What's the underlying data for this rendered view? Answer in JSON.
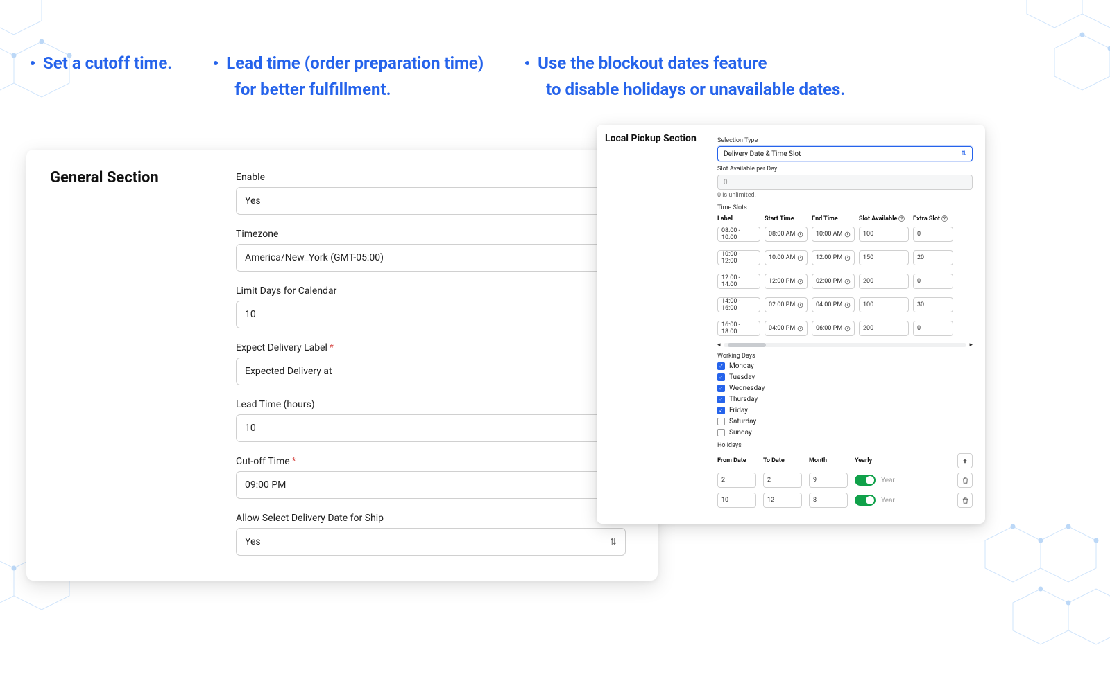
{
  "headlines": {
    "a": "Set a cutoff time.",
    "b1": "Lead time (order preparation time)",
    "b2": "for better fulfillment.",
    "c1": "Use the blockout dates feature",
    "c2": "to disable holidays or unavailable dates."
  },
  "general": {
    "title": "General Section",
    "enable": {
      "label": "Enable",
      "value": "Yes"
    },
    "timezone": {
      "label": "Timezone",
      "value": "America/New_York (GMT-05:00)"
    },
    "limit_days": {
      "label": "Limit Days for Calendar",
      "value": "10"
    },
    "expect_label": {
      "label": "Expect Delivery Label",
      "required": true,
      "value": "Expected Delivery at"
    },
    "lead_time": {
      "label": "Lead Time (hours)",
      "value": "10"
    },
    "cutoff": {
      "label": "Cut-off Time",
      "required": true,
      "value": "09:00 PM"
    },
    "allow_select": {
      "label": "Allow Select Delivery Date for Ship",
      "value": "Yes"
    }
  },
  "pickup": {
    "title": "Local Pickup Section",
    "selection_type": {
      "label": "Selection Type",
      "value": "Delivery Date & Time Slot"
    },
    "slot_avail_day": {
      "label": "Slot Available per Day",
      "value": "0",
      "help": "0 is unlimited."
    },
    "timeslots": {
      "label": "Time Slots",
      "headers": {
        "label": "Label",
        "start": "Start Time",
        "end": "End Time",
        "avail": "Slot Available",
        "extra": "Extra Slot"
      },
      "rows": [
        {
          "label": "08:00 - 10:00",
          "start": "08:00 AM",
          "end": "10:00 AM",
          "avail": "100",
          "extra": "0"
        },
        {
          "label": "10:00 - 12:00",
          "start": "10:00 AM",
          "end": "12:00 PM",
          "avail": "150",
          "extra": "20"
        },
        {
          "label": "12:00 - 14:00",
          "start": "12:00 PM",
          "end": "02:00 PM",
          "avail": "200",
          "extra": "0"
        },
        {
          "label": "14:00 - 16:00",
          "start": "02:00 PM",
          "end": "04:00 PM",
          "avail": "100",
          "extra": "30"
        },
        {
          "label": "16:00 - 18:00",
          "start": "04:00 PM",
          "end": "06:00 PM",
          "avail": "200",
          "extra": "0"
        }
      ]
    },
    "working_days": {
      "label": "Working Days",
      "days": [
        {
          "name": "Monday",
          "checked": true
        },
        {
          "name": "Tuesday",
          "checked": true
        },
        {
          "name": "Wednesday",
          "checked": true
        },
        {
          "name": "Thursday",
          "checked": true
        },
        {
          "name": "Friday",
          "checked": true
        },
        {
          "name": "Saturday",
          "checked": false
        },
        {
          "name": "Sunday",
          "checked": false
        }
      ]
    },
    "holidays": {
      "label": "Holidays",
      "headers": {
        "from": "From Date",
        "to": "To Date",
        "month": "Month",
        "yearly": "Yearly"
      },
      "year_hint": "Year",
      "rows": [
        {
          "from": "2",
          "to": "2",
          "month": "9",
          "yearly": true
        },
        {
          "from": "10",
          "to": "12",
          "month": "8",
          "yearly": true
        }
      ]
    }
  }
}
